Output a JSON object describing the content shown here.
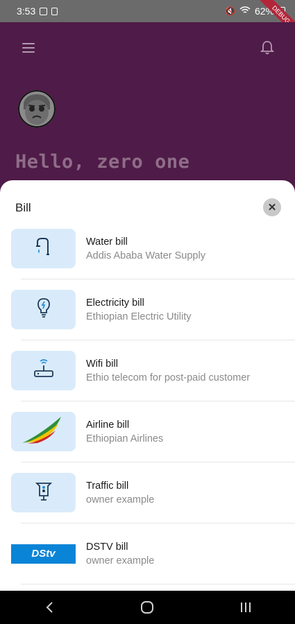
{
  "status": {
    "time": "3:53",
    "battery": "62%",
    "debug_label": "DEBUG"
  },
  "greeting": "Hello, zero one",
  "sheet": {
    "title": "Bill",
    "close_symbol": "✕",
    "items": [
      {
        "name": "Water bill",
        "provider": "Addis Ababa Water Supply",
        "icon": "faucet-icon"
      },
      {
        "name": "Electricity bill",
        "provider": "Ethiopian Electric Utility",
        "icon": "lightbulb-icon"
      },
      {
        "name": "Wifi bill",
        "provider": "Ethio telecom for post-paid customer",
        "icon": "router-icon"
      },
      {
        "name": "Airline bill",
        "provider": "Ethiopian Airlines",
        "icon": "airline-logo"
      },
      {
        "name": "Traffic bill",
        "provider": "owner example",
        "icon": "traffic-light-icon"
      },
      {
        "name": "DSTV bill",
        "provider": "owner example",
        "icon": "dstv-logo"
      }
    ]
  },
  "dstv_logo_text": "DStv",
  "colors": {
    "app_bg": "#4f1b48",
    "thumb_bg": "#d9ebfa",
    "accent": "#0a84d6"
  }
}
